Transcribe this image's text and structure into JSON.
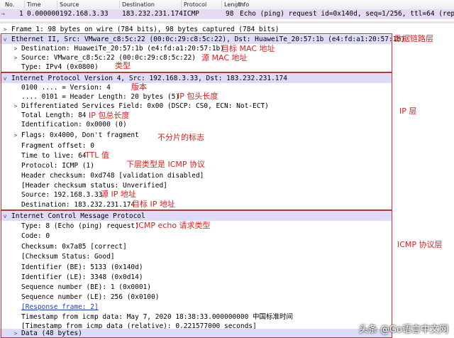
{
  "packet_list": {
    "columns": [
      "No.",
      "Time",
      "Source",
      "Destination",
      "Protocol",
      "Length",
      "Info"
    ],
    "row": {
      "no": "1",
      "time": "0.000000",
      "source": "192.168.3.33",
      "destination": "183.232.231.174",
      "protocol": "ICMP",
      "length": "98",
      "info": "Echo (ping) request  id=0x140d, seq=1/256, ttl=64 (repl"
    }
  },
  "detail": {
    "frame": "Frame 1: 98 bytes on wire (784 bits), 98 bytes captured (784 bits)",
    "ethernet": {
      "header": "Ethernet II, Src: VMware_c8:5c:22 (00:0c:29:c8:5c:22), Dst: HuaweiTe_20:57:1b (e4:fd:a1:20:57:1b)",
      "destination": "Destination: HuaweiTe_20:57:1b (e4:fd:a1:20:57:1b)",
      "source": "Source: VMware_c8:5c:22 (00:0c:29:c8:5c:22)",
      "type": "Type: IPv4 (0x0800)"
    },
    "ip": {
      "header": "Internet Protocol Version 4, Src: 192.168.3.33, Dst: 183.232.231.174",
      "version": "0100 .... = Version: 4",
      "hlen": ".... 0101 = Header Length: 20 bytes (5)",
      "dsf": "Differentiated Services Field: 0x00 (DSCP: CS0, ECN: Not-ECT)",
      "total_length": "Total Length: 84",
      "identification": "Identification: 0x0000 (0)",
      "flags": "Flags: 0x4000, Don't fragment",
      "fragment_offset": "Fragment offset: 0",
      "ttl": "Time to live: 64",
      "protocol": "Protocol: ICMP (1)",
      "checksum": "Header checksum: 0xd748 [validation disabled]",
      "checksum_status": "[Header checksum status: Unverified]",
      "source": "Source: 192.168.3.33",
      "destination": "Destination: 183.232.231.174"
    },
    "icmp": {
      "header": "Internet Control Message Protocol",
      "type": "Type: 8 (Echo (ping) request)",
      "code": "Code: 0",
      "checksum": "Checksum: 0x7a85 [correct]",
      "checksum_status": "[Checksum Status: Good]",
      "id_be": "Identifier (BE): 5133 (0x140d)",
      "id_le": "Identifier (LE): 3348 (0x0d14)",
      "seq_be": "Sequence number (BE): 1 (0x0001)",
      "seq_le": "Sequence number (LE): 256 (0x0100)",
      "response_frame": "[Response frame: 2]",
      "timestamp": "Timestamp from icmp data: May  7, 2020 18:38:33.000000000 中国标准时间",
      "timestamp_rel": "[Timestamp from icmp data (relative): 0.221577000 seconds]",
      "data": "Data (48 bytes)"
    }
  },
  "annotations": {
    "datalink": "数据链路层",
    "dst_mac": "目标 MAC 地址",
    "src_mac": "源 MAC 地址",
    "type": "类型",
    "ip_layer": "IP 层",
    "version": "版本",
    "hlen": "IP 包头长度",
    "total_len": "IP 包总长度",
    "nofrag": "不分片的标志",
    "ttl": "TTL 值",
    "upper": "下层类型是 ICMP 协议",
    "src_ip": "源 IP 地址",
    "dst_ip": "目标 IP 地址",
    "icmp_type": "ICMP echo 请求类型",
    "icmp_layer": "ICMP 协议层"
  },
  "watermark": "头条 @Go语言中文网",
  "colors": {
    "annotation_red": "#e02020",
    "selected_row": "#e6d9f2",
    "highlight_row": "#dcdcf8"
  }
}
